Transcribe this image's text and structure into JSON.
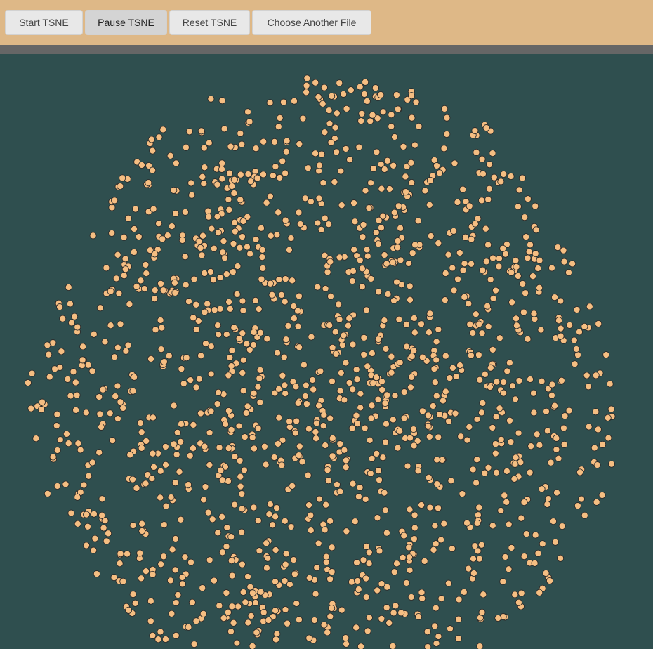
{
  "toolbar": {
    "start_label": "Start TSNE",
    "pause_label": "Pause TSNE",
    "reset_label": "Reset TSNE",
    "choose_label": "Choose Another File"
  },
  "colors": {
    "toolbar_bg": "#deb887",
    "divider": "#666666",
    "plot_bg": "#2f4f4f",
    "point_fill": "#f5be82",
    "point_stroke": "#2b2b2b"
  },
  "chart_data": {
    "type": "scatter",
    "title": "",
    "xlabel": "",
    "ylabel": "",
    "seed": 20250613,
    "count": 1450,
    "description_of_cloud": "single roughly elliptical t-SNE embedding cloud with mild clustering"
  }
}
